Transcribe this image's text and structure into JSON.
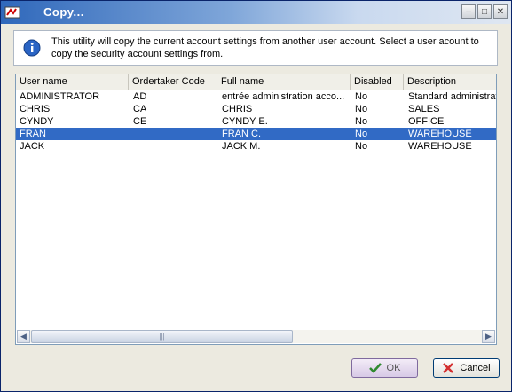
{
  "window": {
    "title": "Copy..."
  },
  "info": {
    "text": "This utility will copy the current account settings from another user account. Select a user acount to copy the security account settings from."
  },
  "table": {
    "columns": [
      "User name",
      "Ordertaker Code",
      "Full name",
      "Disabled",
      "Description"
    ],
    "rows": [
      [
        "ADMINISTRATOR",
        "AD",
        "entrée administration acco...",
        "No",
        "Standard administrati"
      ],
      [
        "CHRIS",
        "CA",
        "CHRIS",
        "No",
        "SALES"
      ],
      [
        "CYNDY",
        "CE",
        "CYNDY E.",
        "No",
        "OFFICE"
      ],
      [
        "FRAN",
        "",
        "FRAN C.",
        "No",
        "WAREHOUSE"
      ],
      [
        "JACK",
        "",
        "JACK M.",
        "No",
        "WAREHOUSE"
      ]
    ],
    "selected_row": 3
  },
  "buttons": {
    "ok": "OK",
    "cancel": "Cancel"
  },
  "colors": {
    "selection": "#316ac5",
    "title_start": "#2f68bb"
  }
}
